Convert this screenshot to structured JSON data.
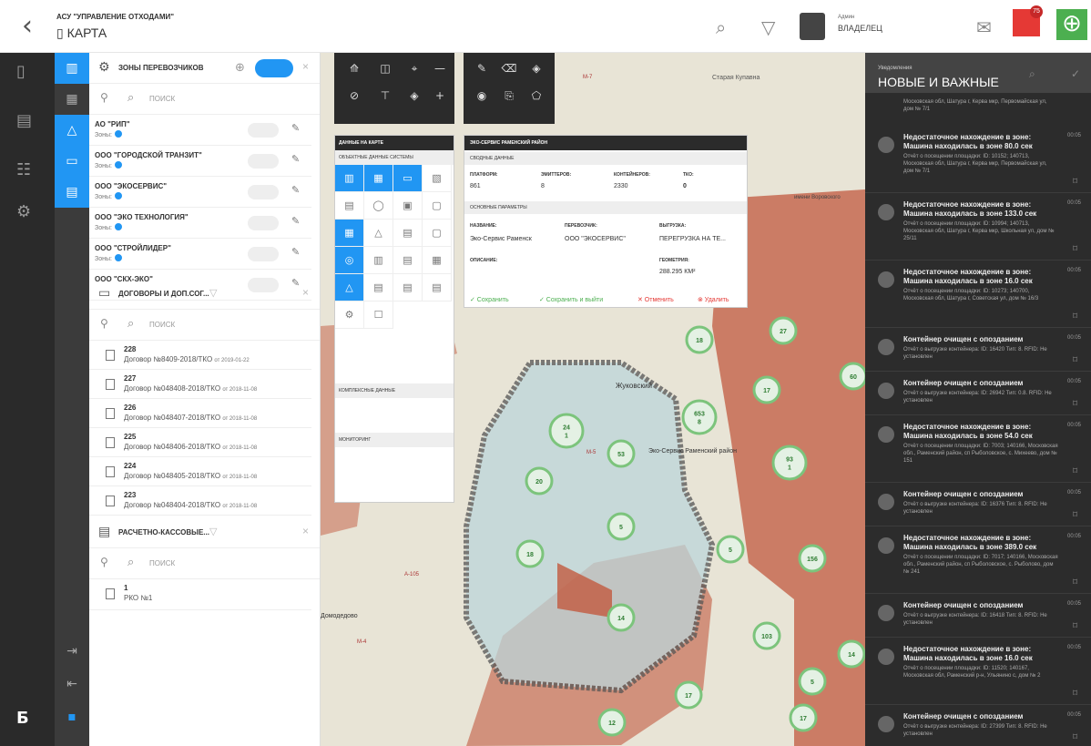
{
  "header": {
    "app_name": "АСУ \"УПРАВЛЕНИЕ ОТХОДАМИ\"",
    "page_title": "КАРТА",
    "admin_role": "Админ",
    "admin_name": "ВЛАДЕЛЕЦ",
    "notif_count": "75"
  },
  "carrier_zones": {
    "title": "ЗОНЫ ПЕРЕВОЗЧИКОВ",
    "search_placeholder": "ПОИСК",
    "items": [
      {
        "name": "АО \"РИП\"",
        "zones": "Зоны:"
      },
      {
        "name": "ООО \"ГОРОДСКОЙ ТРАНЗИТ\"",
        "zones": "Зоны:"
      },
      {
        "name": "ООО \"ЭКОСЕРВИС\"",
        "zones": "Зоны:"
      },
      {
        "name": "ООО \"ЭКО ТЕХНОЛОГИЯ\"",
        "zones": "Зоны:"
      },
      {
        "name": "ООО \"СТРОЙЛИДЕР\"",
        "zones": "Зоны:"
      },
      {
        "name": "ООО \"СКХ-ЭКО\"",
        "zones": ""
      }
    ]
  },
  "contracts": {
    "title": "ДОГОВОРЫ И ДОП.СОГ...",
    "search_placeholder": "ПОИСК",
    "items": [
      {
        "num": "228",
        "name": "Договор №8409-2018/ТКО",
        "date": "от 2019-01-22"
      },
      {
        "num": "227",
        "name": "Договор №048408-2018/ТКО",
        "date": "от 2018-11-08"
      },
      {
        "num": "226",
        "name": "Договор №048407-2018/ТКО",
        "date": "от 2018-11-08"
      },
      {
        "num": "225",
        "name": "Договор №048406-2018/ТКО",
        "date": "от 2018-11-08"
      },
      {
        "num": "224",
        "name": "Договор №048405-2018/ТКО",
        "date": "от 2018-11-08"
      },
      {
        "num": "223",
        "name": "Договор №048404-2018/ТКО",
        "date": "от 2018-11-08"
      }
    ]
  },
  "cash": {
    "title": "РАСЧЕТНО-КАССОВЫЕ...",
    "search_placeholder": "ПОИСК",
    "items": [
      {
        "num": "1",
        "name": "РКО №1"
      }
    ]
  },
  "map_data": {
    "title": "ДАННЫЕ НА КАРТЕ",
    "system": "ОБЪЕКТНЫЕ ДАННЫЕ СИСТЕМЫ",
    "complex": "КОМПЛЕКСНЫЕ ДАННЫЕ",
    "monitoring": "МОНИТОРИНГ"
  },
  "eco": {
    "title": "ЭКО-СЕРВИС РАМЕНСКИЙ РАЙОН",
    "summary": "СВОДНЫЕ ДАННЫЕ",
    "platforms_l": "ПЛАТФОРМ:",
    "platforms": "861",
    "emitters_l": "ЭМИТТЕРОВ:",
    "emitters": "8",
    "containers_l": "КОНТЕЙНЕРОВ:",
    "containers": "2330",
    "tko_l": "ТКО:",
    "tko": "0",
    "main": "ОСНОВНЫЕ ПАРАМЕТРЫ",
    "name_l": "НАЗВАНИЕ:",
    "name": "Эко-Сервис Раменск",
    "carrier_l": "ПЕРЕВОЗЧИК:",
    "carrier": "ООО \"ЭКОСЕРВИС\"",
    "unload_l": "ВЫГРУЗКА:",
    "unload": "ПЕРЕГРУЗКА НА ТЕ...",
    "desc_l": "ОПИСАНИЕ:",
    "geom_l": "ГЕОМЕТРИЯ:",
    "geom": "288.295 КМ²",
    "save": "✓ Сохранить",
    "save_exit": "✓ Сохранить и выйти",
    "cancel": "✕ Отменить",
    "delete": "⊗ Удалить"
  },
  "map_labels": {
    "m7": "М-7",
    "kupavna": "Старая Купавна",
    "vorovskogo": "имени Воровского",
    "zhukovsky": "Жуковский",
    "ramensky": "Эко-Сервис Раменский район",
    "domodedovo": "Домодедово",
    "a105": "А-105",
    "m4": "М-4",
    "m5": "М-5"
  },
  "clusters": [
    "653\n8",
    "24\n1",
    "53",
    "20",
    "5",
    "18",
    "14",
    "5",
    "17",
    "156",
    "27",
    "18",
    "17",
    "12",
    "17",
    "103",
    "5",
    "14",
    "60",
    "93\n1"
  ],
  "notifications": {
    "subtitle": "Уведомления",
    "title": "НОВЫЕ И ВАЖНЫЕ",
    "top_trail": "Московская обл, Шатура г, Керва мкр, Первомайская ул, дом № 7/1",
    "items": [
      {
        "title": "Недостаточное нахождение в зоне: Машина находилась в зоне 80.0 сек",
        "time": "00:05",
        "body": "Отчёт о посещении площадки: ID: 10152; 140713, Московская обл, Шатура г, Керва мкр, Первомайская ул, дом № 7/1"
      },
      {
        "title": "Недостаточное нахождение в зоне: Машина находилась в зоне 133.0 сек",
        "time": "00:05",
        "body": "Отчёт о посещении площадки: ID: 10994; 140713, Московская обл, Шатура г, Керва мкр, Школьная ул, дом № 25/11"
      },
      {
        "title": "Недостаточное нахождение в зоне: Машина находилась в зоне 16.0 сек",
        "time": "00:05",
        "body": "Отчёт о посещении площадки: ID: 10273; 140700, Московская обл, Шатура г, Советская ул, дом № 16/3"
      },
      {
        "title": "Контейнер очищен с опозданием",
        "time": "00:05",
        "body": "Отчёт о выгрузке контейнера: ID: 16420 Тип: 8. RFID: Не установлен"
      },
      {
        "title": "Контейнер очищен с опозданием",
        "time": "00:05",
        "body": "Отчёт о выгрузке контейнера: ID: 26942 Тип: 0.8. RFID: Не установлен"
      },
      {
        "title": "Недостаточное нахождение в зоне: Машина находилась в зоне 54.0 сек",
        "time": "00:05",
        "body": "Отчёт о посещении площадки: ID: 7003; 140166, Московская обл., Раменский район, сп Рыболовское, с. Михеево, дом № 151"
      },
      {
        "title": "Контейнер очищен с опозданием",
        "time": "00:05",
        "body": "Отчёт о выгрузке контейнера: ID: 16376 Тип: 8. RFID: Не установлен"
      },
      {
        "title": "Недостаточное нахождение в зоне: Машина находилась в зоне 389.0 сек",
        "time": "00:05",
        "body": "Отчёт о посещении площадки: ID: 7017; 140166, Московская обл., Раменский район, сп Рыболовское, с. Рыболово, дом № 241"
      },
      {
        "title": "Контейнер очищен с опозданием",
        "time": "00:05",
        "body": "Отчёт о выгрузке контейнера: ID: 16418 Тип: 8. RFID: Не установлен"
      },
      {
        "title": "Недостаточное нахождение в зоне: Машина находилась в зоне 16.0 сек",
        "time": "00:05",
        "body": "Отчёт о посещении площадки: ID: 11520; 140167, Московская обл, Раменский р-н, Ульянино с, дом № 2"
      },
      {
        "title": "Контейнер очищен с опозданием",
        "time": "00:05",
        "body": "Отчёт о выгрузке контейнера: ID: 27399 Тип: 8. RFID: Не установлен"
      }
    ]
  }
}
